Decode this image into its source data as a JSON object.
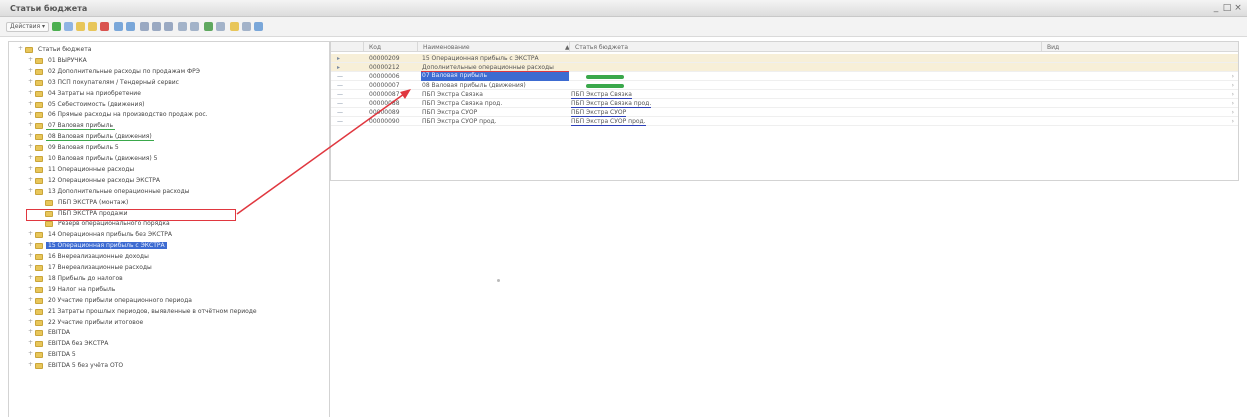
{
  "window": {
    "title": "Статьи бюджета",
    "controls": [
      "_",
      "□",
      "×"
    ]
  },
  "toolbar": {
    "actions_label": "Действия ▾",
    "icons": [
      "add-icon",
      "copy-icon",
      "add-group-icon",
      "edit-icon",
      "delete-icon",
      "tree-icon",
      "hierarchy-icon",
      "search-icon",
      "filter-icon",
      "filter-off-icon",
      "sort-asc-icon",
      "sort-desc-icon",
      "refresh-icon",
      "history-icon",
      "print-icon",
      "settings-icon",
      "help-icon"
    ]
  },
  "tree": {
    "items": [
      {
        "label": "Статьи бюджета",
        "level": 0,
        "type": "root"
      },
      {
        "label": "01 ВЫРУЧКА",
        "level": 1
      },
      {
        "label": "02 Дополнительные расходы по продажам ФРЭ",
        "level": 1
      },
      {
        "label": "03 ПСП покупателям / Тендерный сервис",
        "level": 1
      },
      {
        "label": "04 Затраты на приобретение",
        "level": 1
      },
      {
        "label": "05 Себестоимость (движения)",
        "level": 1
      },
      {
        "label": "06 Прямые расходы на производство продаж рос.",
        "level": 1
      },
      {
        "label": "07 Валовая прибыль",
        "level": 1,
        "underline": "green"
      },
      {
        "label": "08 Валовая прибыль (движения)",
        "level": 1,
        "underline": "green"
      },
      {
        "label": "09 Валовая прибыль 5",
        "level": 1
      },
      {
        "label": "10 Валовая прибыль (движения) 5",
        "level": 1
      },
      {
        "label": "11 Операционные расходы",
        "level": 1
      },
      {
        "label": "12 Операционные расходы ЭКСТРА",
        "level": 1
      },
      {
        "label": "13 Дополнительные операционные расходы",
        "level": 1,
        "boxed": true
      },
      {
        "label": "ПБП ЭКСТРА (монтаж)",
        "level": 2
      },
      {
        "label": "ПБП ЭКСТРА продажи",
        "level": 2
      },
      {
        "label": "Резерв операционального порядка",
        "level": 2
      },
      {
        "label": "14 Операционная прибыль без ЭКСТРА",
        "level": 1
      },
      {
        "label": "15 Операционная прибыль с ЭКСТРА",
        "level": 1,
        "highlighted": true
      },
      {
        "label": "16 Внереализационные доходы",
        "level": 1
      },
      {
        "label": "17 Внереализационные расходы",
        "level": 1
      },
      {
        "label": "18 Прибыль до налогов",
        "level": 1
      },
      {
        "label": "19 Налог на прибыль",
        "level": 1
      },
      {
        "label": "20 Участие прибыли операционного периода",
        "level": 1
      },
      {
        "label": "21 Затраты прошлых периодов, выявленные в отчётном периоде",
        "level": 1
      },
      {
        "label": "22 Участие прибыли итоговое",
        "level": 1
      },
      {
        "label": "EBITDA",
        "level": 1
      },
      {
        "label": "EBITDA без ЭКСТРА",
        "level": 1
      },
      {
        "label": "EBITDA 5",
        "level": 1
      },
      {
        "label": "EBITDA 5 без учёта ОТО",
        "level": 1
      }
    ]
  },
  "grid": {
    "columns": [
      "Код",
      "Наименование",
      "Статья бюджета",
      "Вид"
    ],
    "sort_indicator": "▲",
    "rows": [
      {
        "mark": "▸",
        "code": "00000209",
        "name": "15 Операционная прибыль с ЭКСТРА",
        "status": "",
        "group": true
      },
      {
        "mark": "▸",
        "code": "00000212",
        "name": "Дополнительные операционные расходы",
        "status": "",
        "group": true,
        "underline": "red"
      },
      {
        "mark": "—",
        "code": "00000006",
        "name": "07 Валовая прибыль",
        "status": "",
        "highlighted": true,
        "green_mark": true
      },
      {
        "mark": "—",
        "code": "00000007",
        "name": "08 Валовая прибыль (движения)",
        "status": "",
        "green_mark": true
      },
      {
        "mark": "—",
        "code": "00000087",
        "name": "ПБП Экстра Связка",
        "status": "ПБП Экстра Связка",
        "underline": "blue"
      },
      {
        "mark": "—",
        "code": "00000088",
        "name": "ПБП Экстра Связка прод.",
        "status": "ПБП Экстра Связка прод.",
        "underline": "blue"
      },
      {
        "mark": "—",
        "code": "00000089",
        "name": "ПБП Экстра СУОР",
        "status": "ПБП Экстра СУОР",
        "underline": "blue"
      },
      {
        "mark": "—",
        "code": "00000090",
        "name": "ПБП Экстра СУОР прод.",
        "status": "ПБП Экстра СУОР прод.",
        "underline": "blue"
      }
    ]
  },
  "colors": {
    "selection": "#3d6bd1",
    "annotation_red": "#e0373f",
    "annotation_green": "#3aa84b",
    "annotation_blue": "#2c3fb8",
    "folder": "#e8c65a"
  }
}
